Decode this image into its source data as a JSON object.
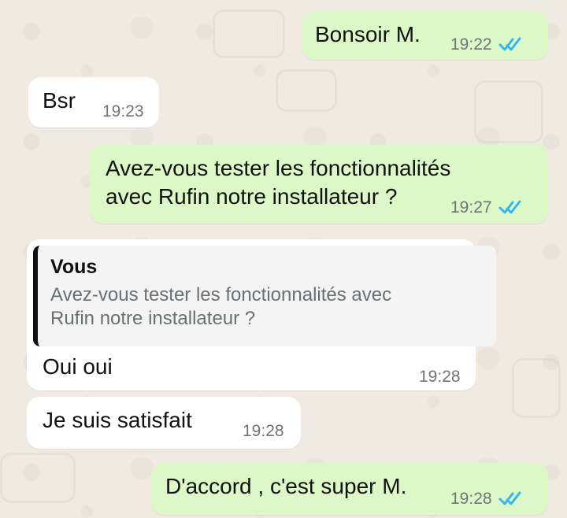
{
  "conversation": {
    "messages": [
      {
        "id": "m1",
        "direction": "outgoing",
        "text": "Bonsoir M.",
        "time": "19:22",
        "status": "read"
      },
      {
        "id": "m2",
        "direction": "incoming",
        "text": "Bsr",
        "time": "19:23"
      },
      {
        "id": "m3",
        "direction": "outgoing",
        "text": "Avez-vous tester les fonctionnalités\navec Rufin notre installateur ?",
        "time": "19:27",
        "status": "read"
      },
      {
        "id": "m4",
        "direction": "incoming",
        "reply_to": {
          "author": "Vous",
          "text": "Avez-vous tester les fonctionnalités avec\nRufin notre installateur ?"
        },
        "text": "Oui oui",
        "time": "19:28"
      },
      {
        "id": "m5",
        "direction": "incoming",
        "text": "Je suis satisfait",
        "time": "19:28"
      },
      {
        "id": "m6",
        "direction": "outgoing",
        "text": "D'accord , c'est super M.",
        "time": "19:28",
        "status": "read"
      }
    ]
  },
  "theme": {
    "outgoing_bubble": "#dcf8c6",
    "incoming_bubble": "#ffffff",
    "wallpaper": "#f1eae2",
    "read_tick": "#34b7f1"
  }
}
